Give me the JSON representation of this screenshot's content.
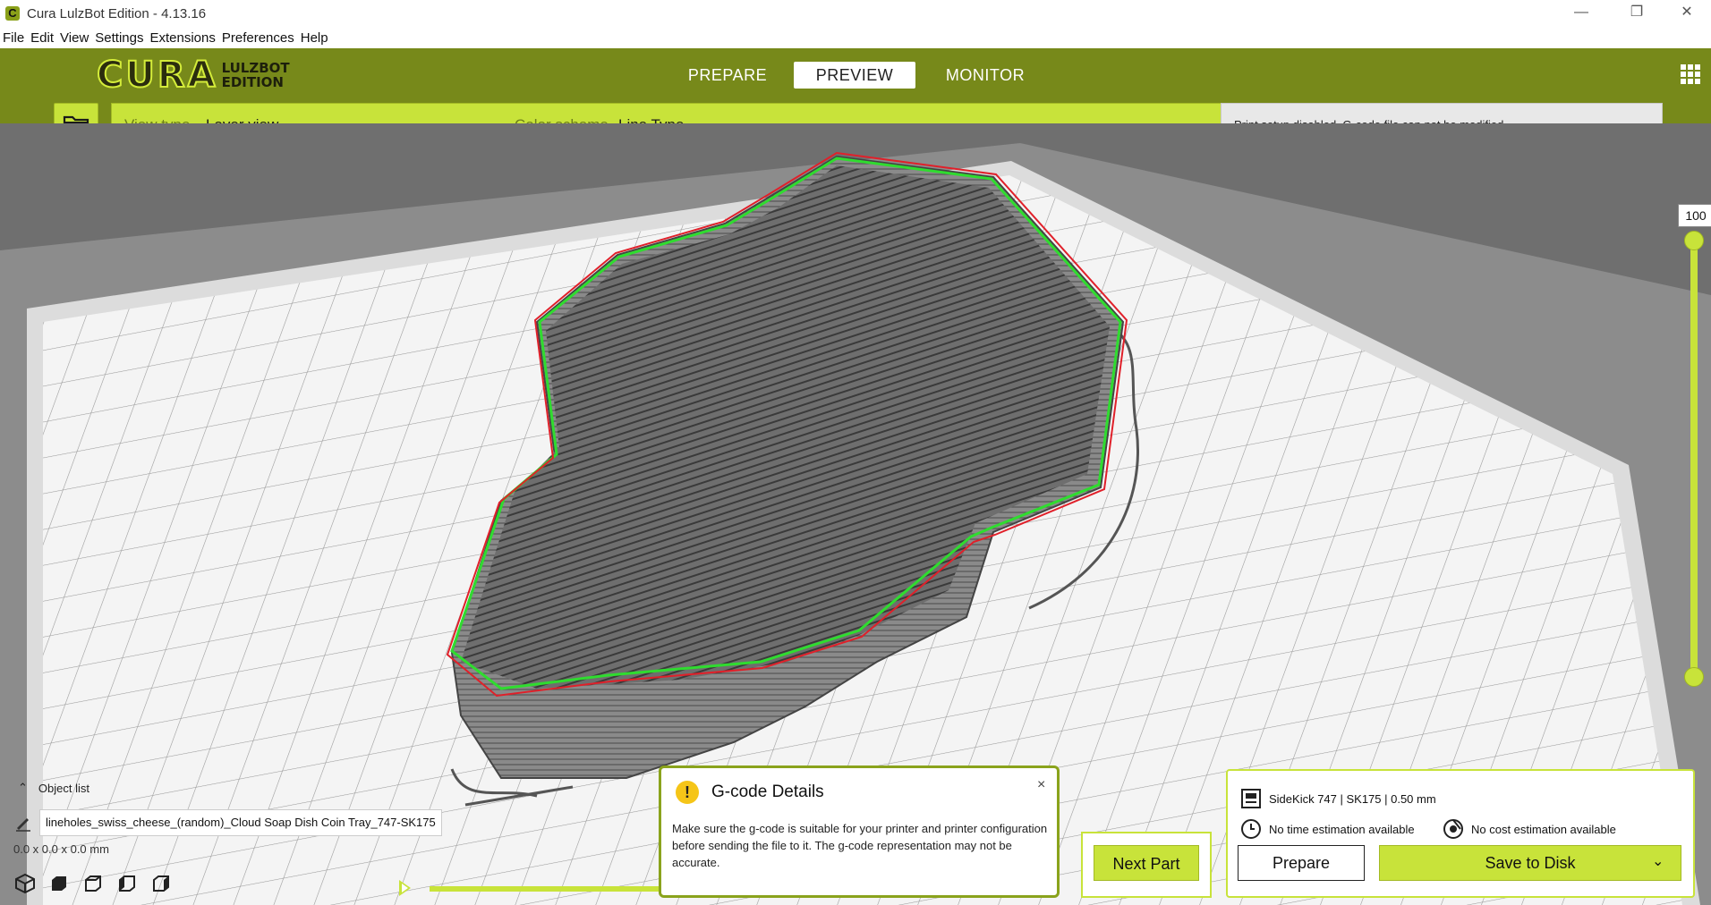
{
  "window": {
    "title": "Cura LulzBot Edition - 4.13.16",
    "app_icon": "C",
    "minimize": "—",
    "maximize": "❐",
    "close": "✕"
  },
  "menu": [
    "File",
    "Edit",
    "View",
    "Settings",
    "Extensions",
    "Preferences",
    "Help"
  ],
  "logo": {
    "main": "CURA",
    "sub_line1": "LULZBOT",
    "sub_line2": "EDITION"
  },
  "stages": [
    {
      "label": "PREPARE",
      "active": false
    },
    {
      "label": "PREVIEW",
      "active": true
    },
    {
      "label": "MONITOR",
      "active": false
    }
  ],
  "toolbar": {
    "view_type_label": "View type",
    "view_type_value": "Layer view",
    "color_scheme_label": "Color scheme",
    "color_scheme_value": "Line Type",
    "notice": "Print setup disabled. G-code file can not be modified."
  },
  "layer_slider": {
    "value": "100"
  },
  "object_list": {
    "label": "Object list",
    "object_name": "lineholes_swiss_cheese_(random)_Cloud Soap Dish Coin Tray_747-SK175",
    "dimensions": "0.0 x 0.0 x 0.0 mm"
  },
  "gcode_details": {
    "title": "G-code Details",
    "warning_glyph": "!",
    "close_glyph": "×",
    "body": "Make sure the g-code is suitable for your printer and printer configuration before sending the file to it. The g-code representation may not be accurate."
  },
  "next_part": "Next Part",
  "print_panel": {
    "printer": "SideKick 747 | SK175 | 0.50 mm",
    "time": "No time estimation available",
    "cost": "No cost estimation available",
    "prepare": "Prepare",
    "save": "Save to Disk"
  },
  "colors": {
    "accent": "#c8e33a",
    "header": "#77891a",
    "wall_inner": "#2fdc2f",
    "wall_outer": "#e0202a"
  }
}
